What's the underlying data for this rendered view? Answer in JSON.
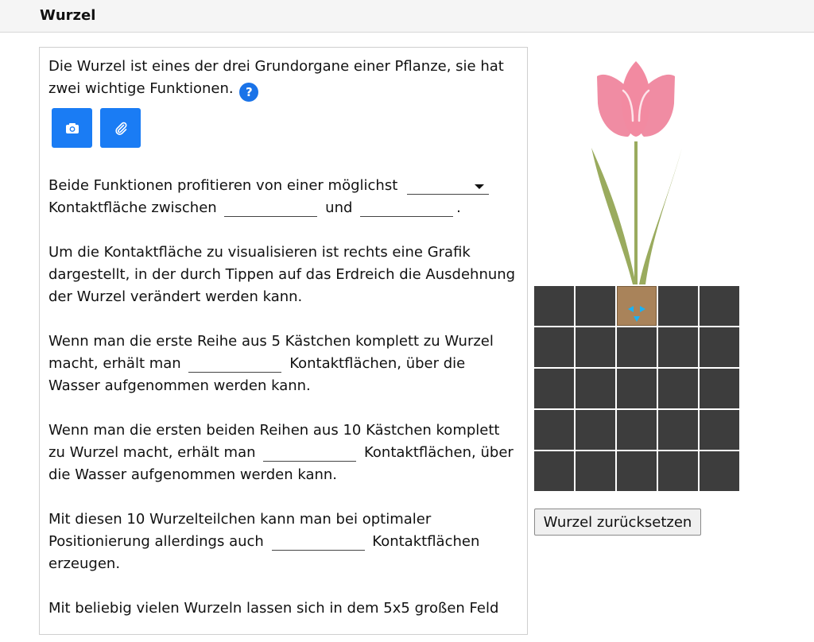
{
  "header": {
    "title": "Wurzel"
  },
  "intro": {
    "text": "Die Wurzel ist eines der drei Grundorgane einer Pflanze, sie hat zwei wichtige Funktionen.",
    "help_label": "?"
  },
  "toolbar": {
    "camera_icon": "camera-icon",
    "attach_icon": "paperclip-icon"
  },
  "para1": {
    "before": "Beide Funktionen profitieren von einer möglichst",
    "select_value": "",
    "middle": "Kontaktfläche zwischen",
    "and": "und",
    "end": "."
  },
  "para2": {
    "text": "Um die Kontaktfläche zu visualisieren ist rechts eine Grafik dargestellt, in der durch Tippen auf das Erdreich die Ausdehnung der Wurzel verändert werden kann."
  },
  "para3": {
    "before": "Wenn man die erste Reihe aus 5 Kästchen komplett zu Wurzel macht, erhält man",
    "after": "Kontaktflächen, über die Wasser aufgenommen werden kann."
  },
  "para4": {
    "before": "Wenn man die ersten beiden Reihen aus 10 Kästchen komplett zu Wurzel macht, erhält man",
    "after": "Kontaktflächen, über die Wasser aufgenommen werden kann."
  },
  "para5": {
    "before": "Mit diesen 10 Wurzelteilchen kann man bei optimaler Positionierung allerdings auch",
    "after": "Kontaktflächen erzeugen."
  },
  "para6": {
    "before": "Mit beliebig vielen Wurzeln lassen sich in dem 5x5 großen Feld"
  },
  "soil": {
    "rows": 5,
    "cols": 5,
    "root_cells": [
      [
        0,
        2
      ]
    ],
    "colors": {
      "soil": "#3d3d3d",
      "root": "#a9835a",
      "arrow": "#1ab2f5"
    }
  },
  "reset_button": {
    "label": "Wurzel zurücksetzen"
  },
  "colors": {
    "accent": "#1a7cf4",
    "petal": "#f08ca3",
    "leaf": "#9aab5e"
  }
}
